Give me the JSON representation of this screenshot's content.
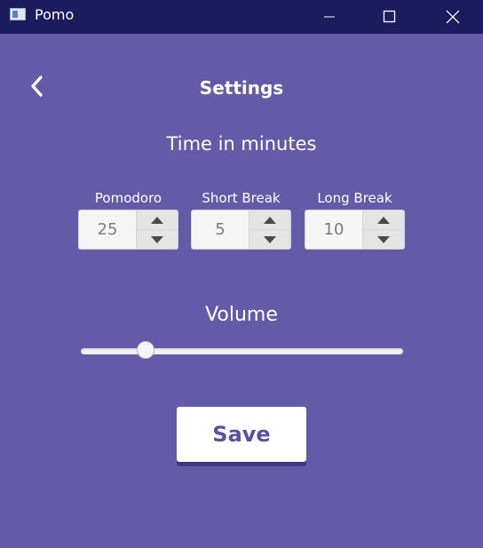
{
  "window": {
    "title": "Pomo",
    "colors": {
      "titlebar": "#1b1c5e",
      "background": "#635aa8"
    }
  },
  "header": {
    "title": "Settings",
    "back_icon": "chevron-left-icon"
  },
  "time_section": {
    "title": "Time in minutes",
    "fields": [
      {
        "label": "Pomodoro",
        "value": "25"
      },
      {
        "label": "Short Break",
        "value": "5"
      },
      {
        "label": "Long Break",
        "value": "10"
      }
    ]
  },
  "volume": {
    "title": "Volume",
    "level": 0.2
  },
  "save": {
    "label": "Save",
    "color": "#5a519b"
  }
}
